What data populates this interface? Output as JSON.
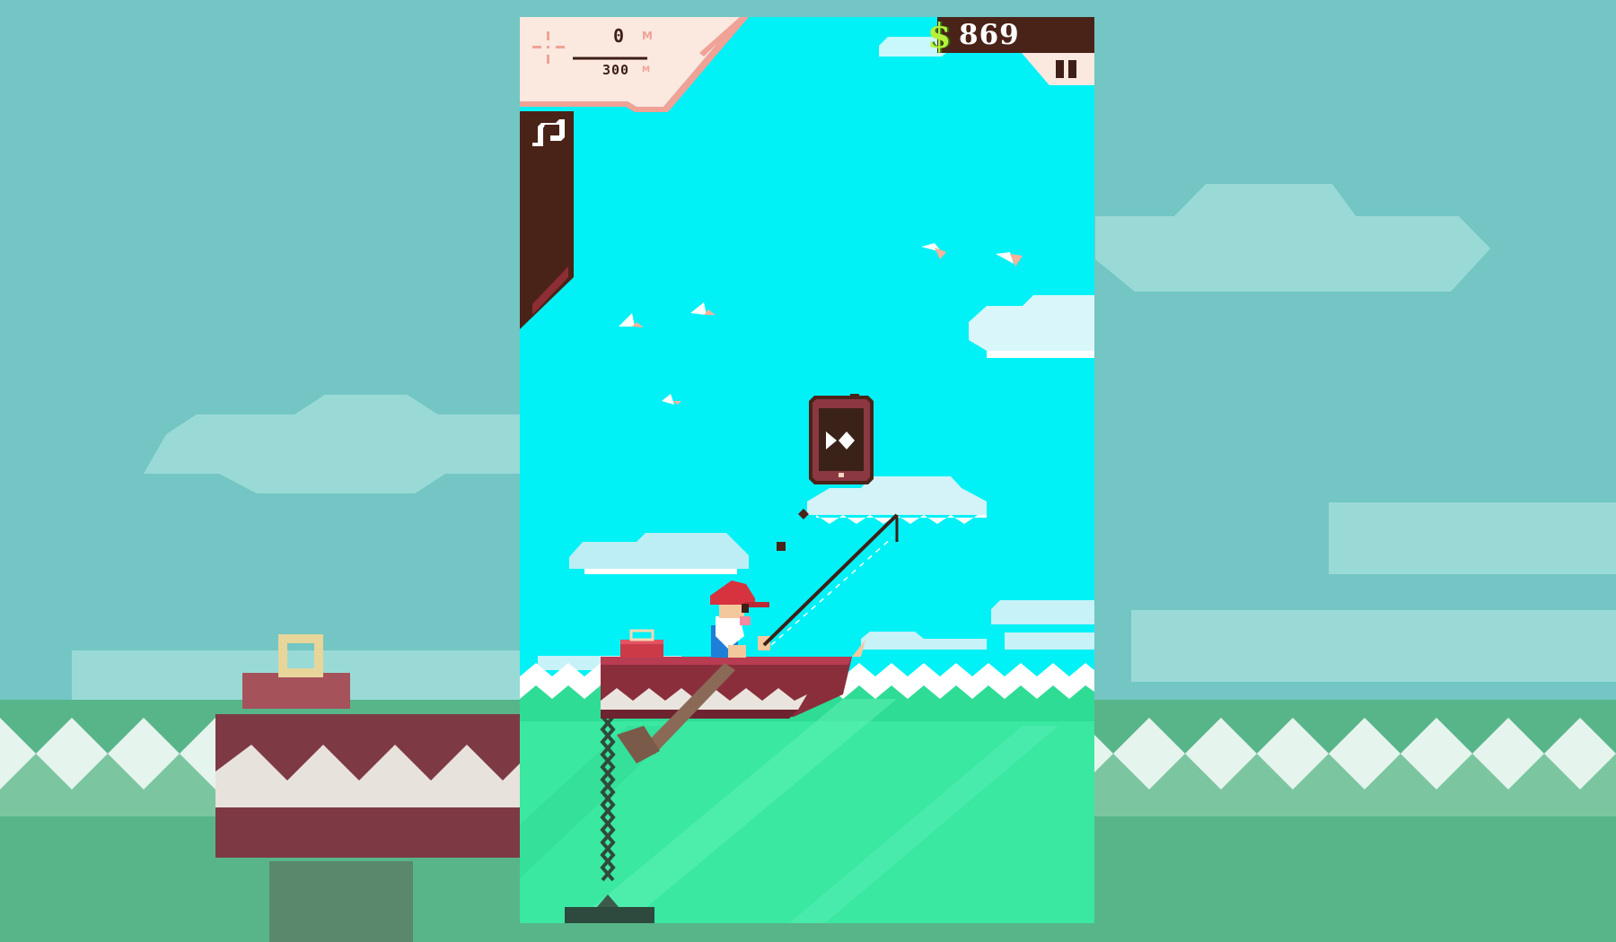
{
  "hud": {
    "money_symbol": "$",
    "money": "869",
    "depth_current": "0",
    "depth_unit": "M",
    "depth_max": "300",
    "depth_max_unit": "M"
  },
  "icons": {
    "music": "music-note-icon",
    "pause": "pause-icon",
    "target": "crosshair-icon",
    "phone_play": "fast-forward-icon"
  },
  "colors": {
    "sky": "#00f1f6",
    "sea": "#3ae8a2",
    "hud_dark": "#4a2318",
    "hud_light": "#fbe8df",
    "money_green": "#b7ef3c",
    "boat": "#8a2e3c"
  }
}
